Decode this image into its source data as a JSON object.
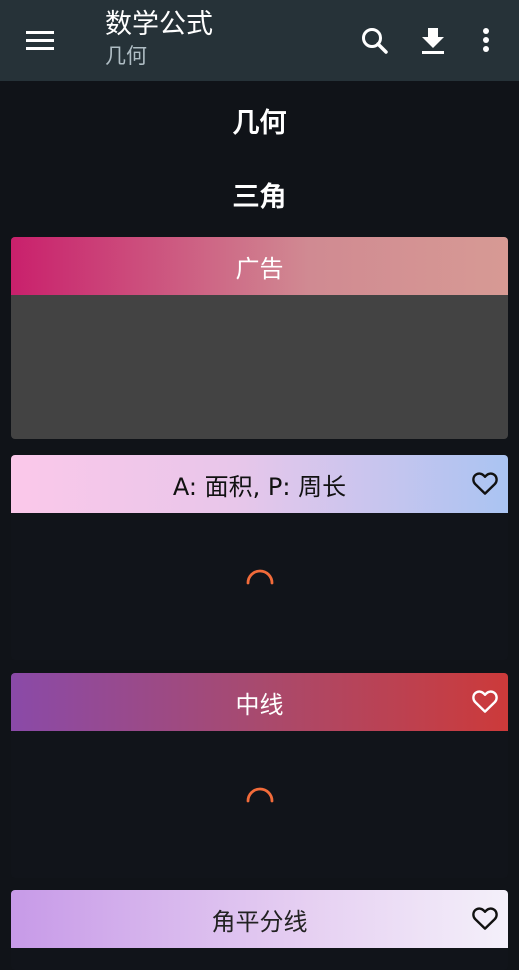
{
  "appbar": {
    "title": "数学公式",
    "subtitle": "几何",
    "icons": [
      "menu-icon",
      "search-icon",
      "download-icon",
      "more-vertical-icon"
    ]
  },
  "content": {
    "heading": "几何",
    "section": "三角"
  },
  "cards": {
    "ad": {
      "label": "广告"
    },
    "items": [
      {
        "title": "A: 面积, P: 周长",
        "icon": "heart-outline-icon",
        "state": "loading"
      },
      {
        "title": "中线",
        "icon": "heart-outline-icon",
        "state": "loading"
      },
      {
        "title": "角平分线",
        "icon": "heart-outline-icon"
      }
    ]
  },
  "colors": {
    "appbar": "#263238",
    "background": "#101318",
    "spinner": "#f26b3a"
  }
}
